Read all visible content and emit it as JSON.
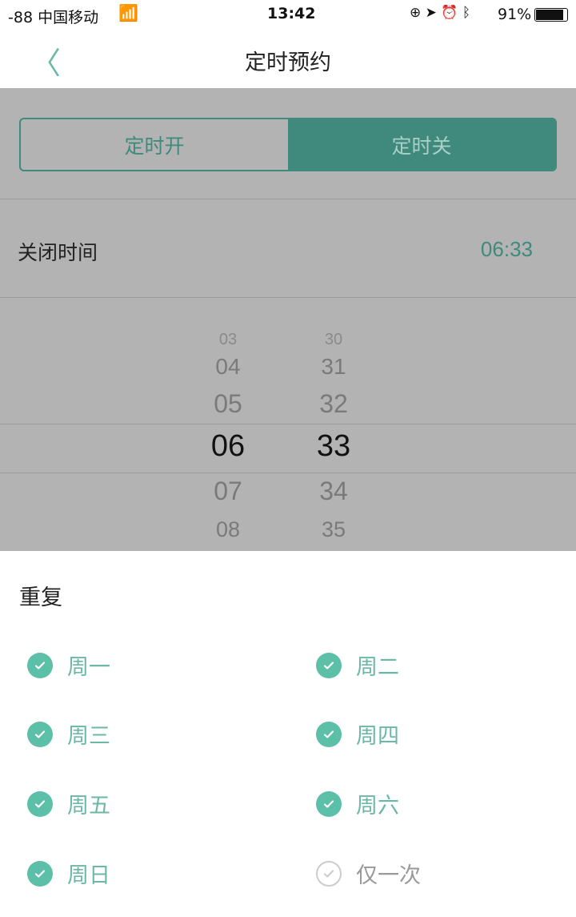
{
  "status_bar": {
    "carrier": "-88 中国移动",
    "time": "13:42",
    "battery": "91%"
  },
  "nav": {
    "title": "定时预约"
  },
  "segments": [
    {
      "label": "定时开",
      "selected": false
    },
    {
      "label": "定时关",
      "selected": true
    }
  ],
  "close_time": {
    "label": "关闭时间",
    "value": "06:33"
  },
  "picker": {
    "hours": [
      "03",
      "04",
      "05",
      "06",
      "07",
      "08"
    ],
    "minutes": [
      "30",
      "31",
      "32",
      "33",
      "34",
      "35"
    ],
    "selected_hour": "06",
    "selected_minute": "33"
  },
  "repeat": {
    "title": "重复",
    "options": [
      {
        "label": "周一",
        "checked": true
      },
      {
        "label": "周二",
        "checked": true
      },
      {
        "label": "周三",
        "checked": true
      },
      {
        "label": "周四",
        "checked": true
      },
      {
        "label": "周五",
        "checked": true
      },
      {
        "label": "周六",
        "checked": true
      },
      {
        "label": "周日",
        "checked": true
      },
      {
        "label": "仅一次",
        "checked": false
      }
    ]
  },
  "colors": {
    "accent": "#5cbfa8",
    "accent_dimmed": "#3f8a7c",
    "overlay": "#b3b3b3"
  }
}
